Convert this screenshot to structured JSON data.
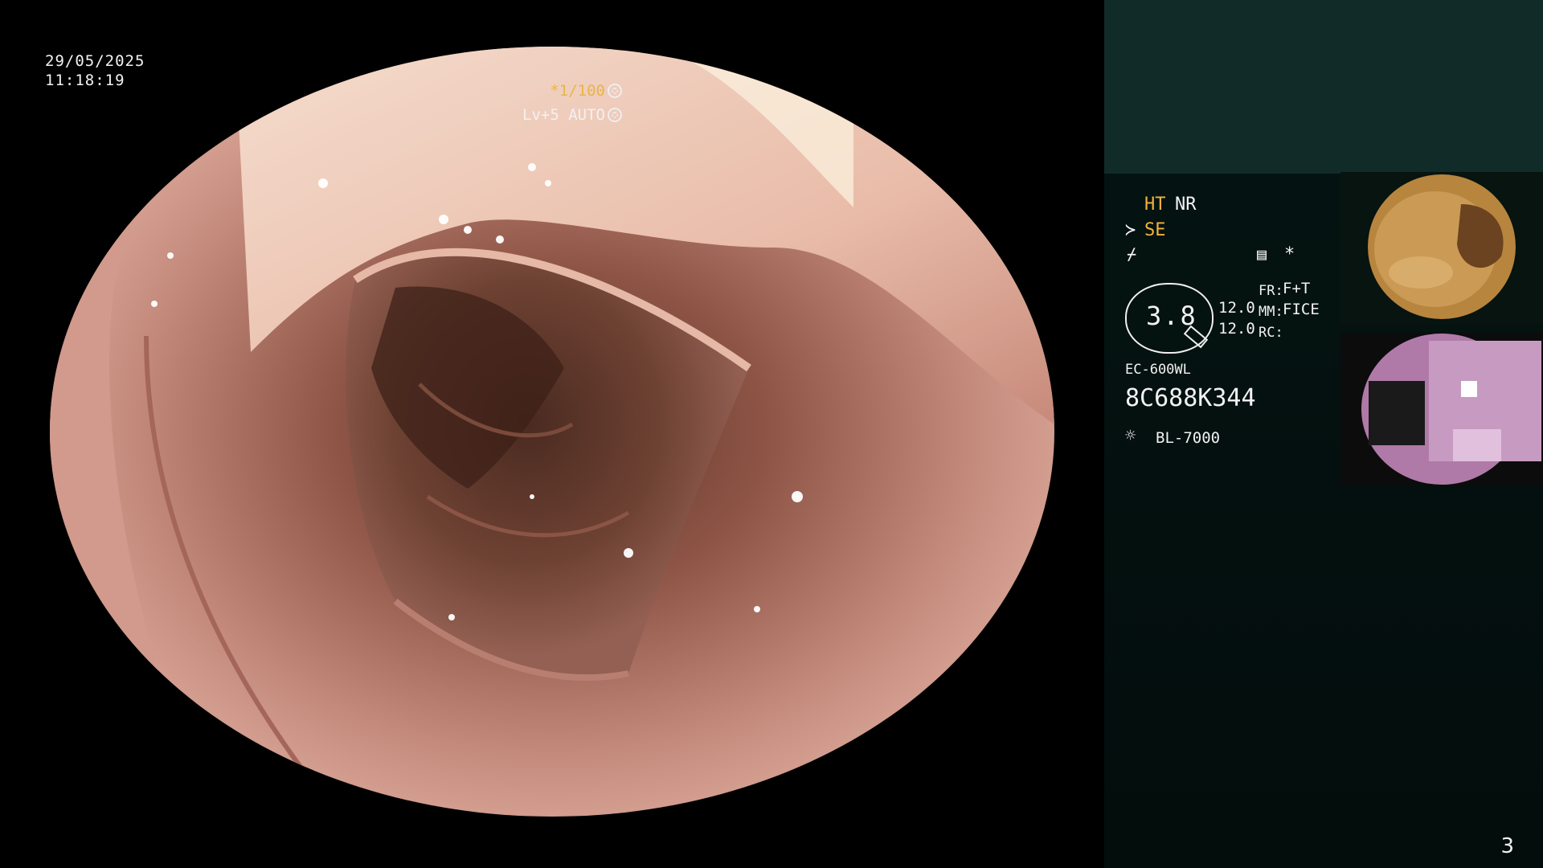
{
  "overlay": {
    "date": "29/05/2025",
    "time": "11:18:19",
    "shutter": "*1/100",
    "level": "Lv+5 AUTO"
  },
  "panel": {
    "ht": "HT",
    "nr": "NR",
    "se": "SE",
    "zoom": "3.8",
    "fr_label": "FR:",
    "fr_value": "F+T",
    "mm_label": "MM:",
    "mm_value": "FICE",
    "rc_label": "RC:",
    "val1": "12.0",
    "val2": "12.0",
    "scope_model": "EC-600WL",
    "serial": "8C688K344",
    "light_source": "BL-7000",
    "page_number": "3"
  },
  "colors": {
    "panel_bg": "#041311",
    "panel_top": "#112b28",
    "accent": "#f3b33d",
    "mucosa": "#c6887e"
  },
  "icons": [
    "shutter-glyph",
    "auto-glyph",
    "enhance-icon",
    "filter-icon",
    "freeze-icon",
    "asterisk-icon",
    "lightbulb-icon"
  ]
}
